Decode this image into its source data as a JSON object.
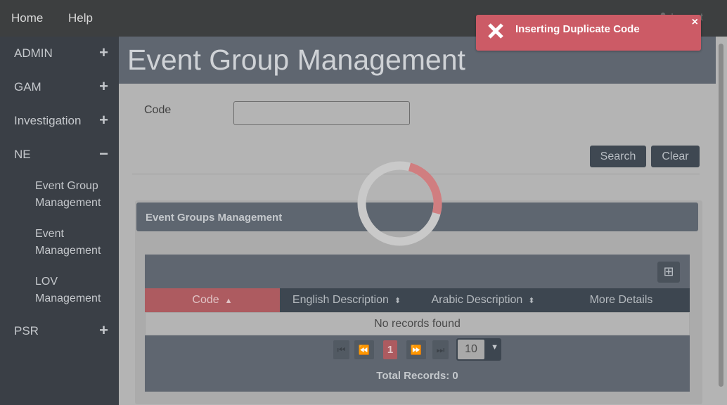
{
  "topbar": {
    "home_label": "Home",
    "help_label": "Help",
    "logout_label": "Logout"
  },
  "sidebar": {
    "items": [
      {
        "label": "ADMIN",
        "toggle": "+"
      },
      {
        "label": "GAM",
        "toggle": "+"
      },
      {
        "label": "Investigation",
        "toggle": "+"
      },
      {
        "label": "NE",
        "toggle": "−"
      },
      {
        "label": "PSR",
        "toggle": "+"
      }
    ],
    "ne_children": [
      {
        "line1": "Event Group",
        "line2": "Management"
      },
      {
        "line1": "Event",
        "line2": "Management"
      },
      {
        "line1": "LOV",
        "line2": "Management"
      }
    ]
  },
  "page": {
    "title": "Event Group Management"
  },
  "search_form": {
    "code_label": "Code",
    "code_value": "",
    "search_label": "Search",
    "clear_label": "Clear"
  },
  "panel": {
    "title": "Event Groups Management"
  },
  "table": {
    "columns": [
      {
        "label": "Code",
        "sort": "▲"
      },
      {
        "label": "English Description",
        "sort": "⬍"
      },
      {
        "label": "Arabic Description",
        "sort": "⬍"
      },
      {
        "label": "More Details"
      }
    ],
    "empty_message": "No records found",
    "column_toggle_icon": "⊞"
  },
  "paginator": {
    "current_page": "1",
    "rows_per_page": "10",
    "total_records": "Total Records: 0"
  },
  "toast": {
    "message": "Inserting Duplicate Code",
    "close": "×",
    "color": "#cc5b66"
  },
  "colors": {
    "accent": "#ad5b60",
    "sidebar": "#3a3f46",
    "header": "#5f6670"
  }
}
